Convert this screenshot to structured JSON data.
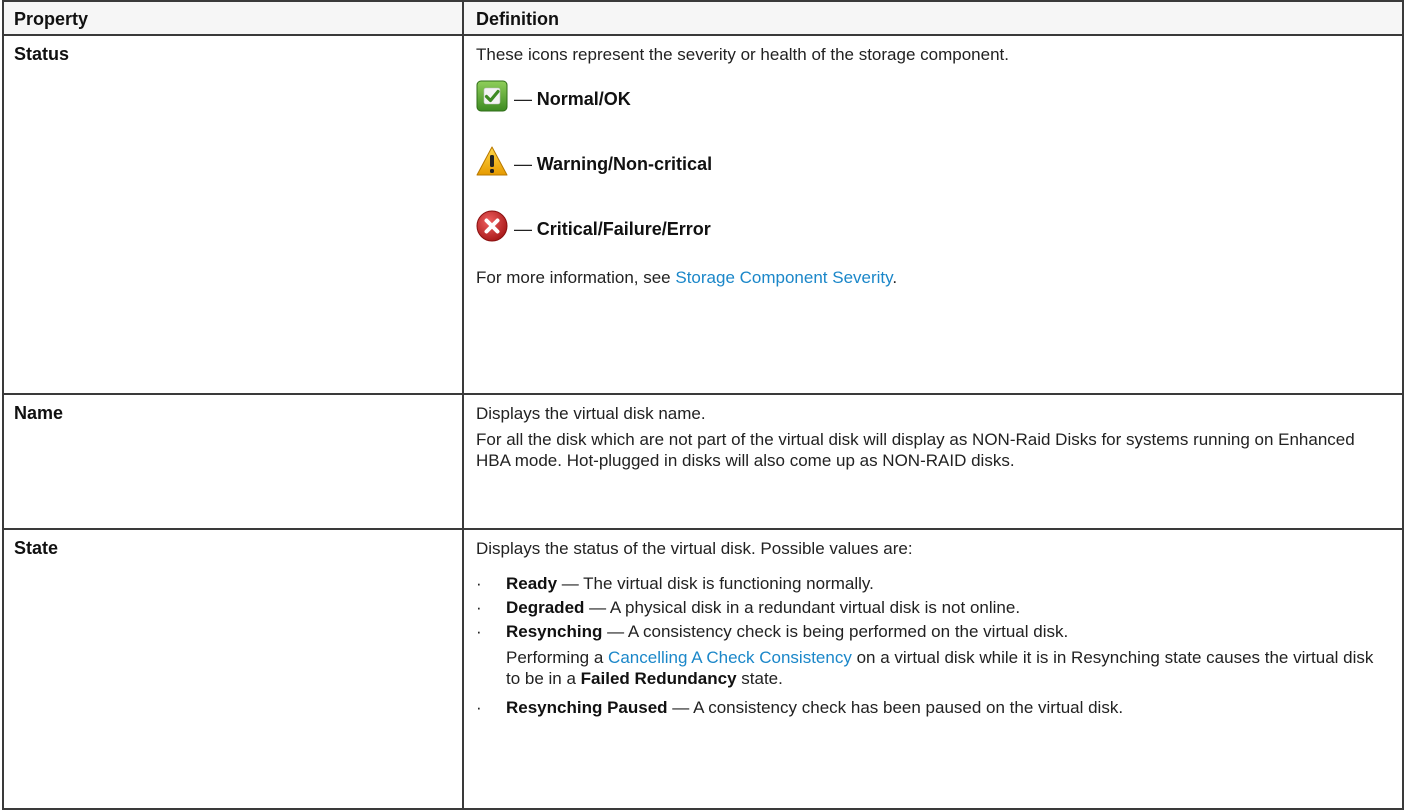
{
  "header": {
    "property": "Property",
    "definition": "Definition"
  },
  "status": {
    "property": "Status",
    "intro": "These icons represent the severity or health of the storage component.",
    "dash": "—",
    "normal": "Normal/OK",
    "warning": "Warning/Non-critical",
    "critical": "Critical/Failure/Error",
    "more_prefix": "For more information, see ",
    "more_link": "Storage Component Severity",
    "more_suffix": ".",
    "colors": {
      "ok": "#4a9a2a",
      "warn": "#f2b000",
      "crit": "#c62828",
      "link": "#1b87c9"
    },
    "icons": [
      "checkmark-ok-icon",
      "warning-triangle-icon",
      "critical-x-icon"
    ]
  },
  "name": {
    "property": "Name",
    "line1": "Displays the virtual disk name.",
    "line2": "For all the disk which are not part of the virtual disk will display as NON-Raid Disks for systems running on Enhanced HBA mode. Hot-plugged in disks will also come up as NON-RAID disks."
  },
  "state": {
    "property": "State",
    "intro": "Displays the status of the virtual disk. Possible values are:",
    "bullet": "·",
    "items": [
      {
        "term": "Ready",
        "desc": " — The virtual disk is functioning normally."
      },
      {
        "term": "Degraded",
        "desc": " — A physical disk in a redundant virtual disk is not online."
      },
      {
        "term": "Resynching",
        "desc": " — A consistency check is being performed on the virtual disk.",
        "sub_prefix": "Performing a ",
        "sub_link": "Cancelling A Check Consistency",
        "sub_mid": " on a virtual disk while it is in Resynching state causes the virtual disk to be in a ",
        "sub_bold": "Failed Redundancy",
        "sub_suffix": " state."
      },
      {
        "term": "Resynching Paused",
        "desc": " — A consistency check has been paused on the virtual disk."
      }
    ]
  }
}
